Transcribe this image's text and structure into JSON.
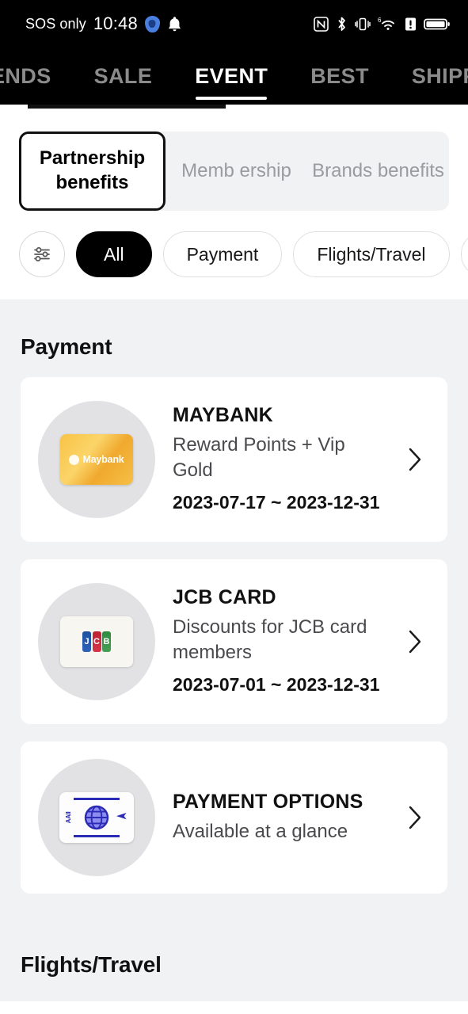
{
  "statusbar": {
    "carrier": "SOS only",
    "time": "10:48",
    "icons": [
      "shield-icon",
      "bell-icon",
      "nfc-icon",
      "bluetooth-icon",
      "vibrate-icon",
      "wifi6-icon",
      "signal-alert-icon",
      "battery-icon"
    ]
  },
  "topnav": {
    "tabs": [
      {
        "label": "ENDS",
        "active": false
      },
      {
        "label": "SALE",
        "active": false
      },
      {
        "label": "EVENT",
        "active": true
      },
      {
        "label": "BEST",
        "active": false
      },
      {
        "label": "SHIPP",
        "active": false
      }
    ]
  },
  "segmented": {
    "items": [
      {
        "label": "Partnership benefits",
        "active": true
      },
      {
        "label": "Memb ership",
        "active": false
      },
      {
        "label": "Brands benefits",
        "active": false
      }
    ]
  },
  "chips": {
    "filter_icon": "sliders-filter-icon",
    "items": [
      {
        "label": "All",
        "active": true
      },
      {
        "label": "Payment",
        "active": false
      },
      {
        "label": "Flights/Travel",
        "active": false
      }
    ]
  },
  "sections": [
    {
      "title": "Payment",
      "cards": [
        {
          "logo": "maybank-card-icon",
          "logo_text": "Maybank",
          "title": "MAYBANK",
          "desc": "Reward Points + Vip Gold",
          "date": "2023-07-17 ~ 2023-12-31",
          "chevron": "chevron-right-icon"
        },
        {
          "logo": "jcb-card-icon",
          "logo_text": "JCB",
          "title": "JCB CARD",
          "desc": "Discounts for JCB card members",
          "date": "2023-07-01 ~ 2023-12-31",
          "chevron": "chevron-right-icon"
        },
        {
          "logo": "payment-options-card-icon",
          "logo_text": "AAII",
          "title": "PAYMENT OPTIONS",
          "desc": "Available at a glance",
          "date": "",
          "chevron": "chevron-right-icon"
        }
      ]
    },
    {
      "title": "Flights/Travel",
      "cards": []
    }
  ],
  "colors": {
    "page_bg": "#f1f2f4",
    "card_bg": "#ffffff",
    "accent_dark": "#000000",
    "maybank_gold": "#f5bd41",
    "jcb_blue": "#1d4f9e",
    "jcb_red": "#bd2231",
    "jcb_green": "#2e8a3e",
    "payment_blue": "#2b2bb5"
  }
}
